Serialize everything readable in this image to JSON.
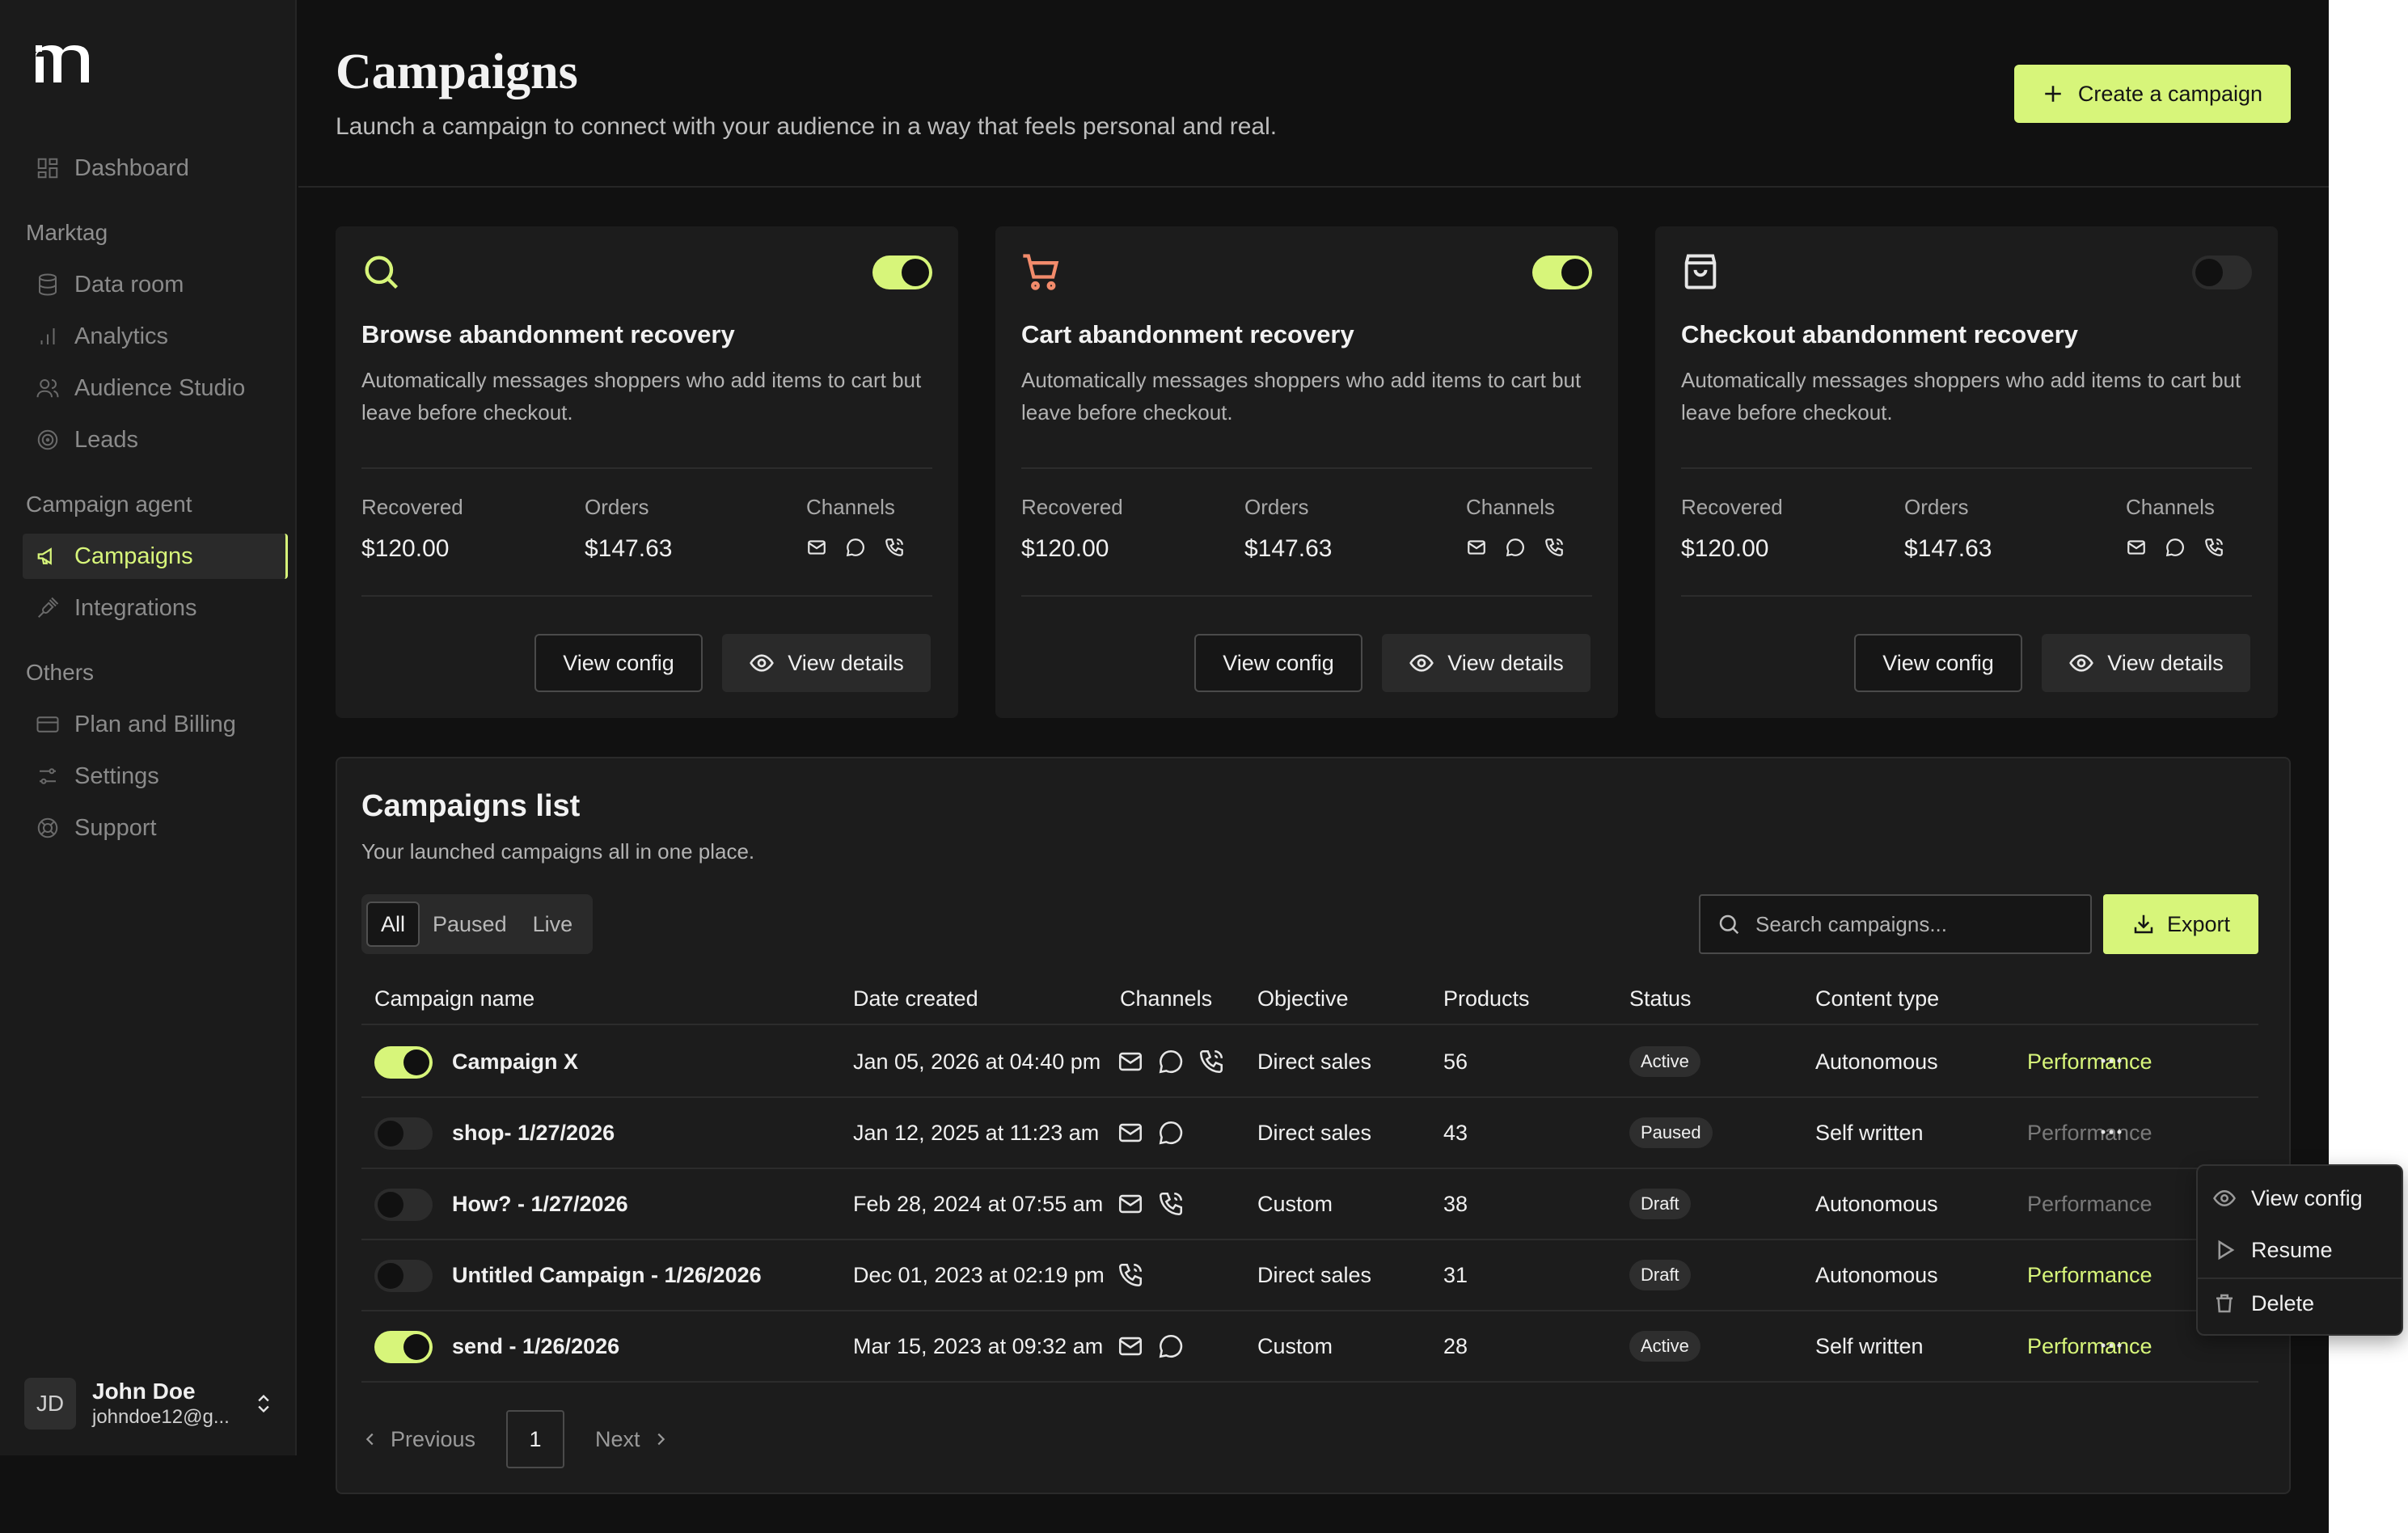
{
  "app": {
    "brand_color": "#d7f57a",
    "background": "#111111"
  },
  "sidebar": {
    "logo": "m-brand-logo",
    "dashboard": "Dashboard",
    "section_marktag": "Marktag",
    "data_room": "Data room",
    "analytics": "Analytics",
    "audience_studio": "Audience Studio",
    "leads": "Leads",
    "section_campaign_agent": "Campaign agent",
    "campaigns": "Campaigns",
    "integrations": "Integrations",
    "section_others": "Others",
    "plan_billing": "Plan and Billing",
    "settings": "Settings",
    "support": "Support",
    "user": {
      "initials": "JD",
      "name": "John Doe",
      "email": "johndoe12@g..."
    }
  },
  "header": {
    "title": "Campaigns",
    "subtitle": "Launch a campaign to connect with your audience in a way that feels personal and real.",
    "create_button": "Create a campaign"
  },
  "cards": [
    {
      "icon": "search-icon",
      "icon_color": "#d7f57a",
      "enabled": true,
      "title": "Browse abandonment recovery",
      "description": "Automatically messages shoppers who add items to cart but leave before checkout.",
      "recovered_label": "Recovered",
      "recovered": "$120.00",
      "orders_label": "Orders",
      "orders": "$147.63",
      "channels_label": "Channels",
      "view_config": "View config",
      "view_details": "View details"
    },
    {
      "icon": "cart-icon",
      "icon_color": "#f28b6b",
      "enabled": true,
      "title": "Cart abandonment recovery",
      "description": "Automatically messages shoppers who add items to cart but leave before checkout.",
      "recovered_label": "Recovered",
      "recovered": "$120.00",
      "orders_label": "Orders",
      "orders": "$147.63",
      "channels_label": "Channels",
      "view_config": "View config",
      "view_details": "View details"
    },
    {
      "icon": "shopping-bag-icon",
      "icon_color": "#e6e6e6",
      "enabled": false,
      "title": "Checkout abandonment recovery",
      "description": "Automatically messages shoppers who add items to cart but leave before checkout.",
      "recovered_label": "Recovered",
      "recovered": "$120.00",
      "orders_label": "Orders",
      "orders": "$147.63",
      "channels_label": "Channels",
      "view_config": "View config",
      "view_details": "View details"
    }
  ],
  "list": {
    "title": "Campaigns list",
    "subtitle": "Your launched campaigns all in one place.",
    "tabs": [
      "All",
      "Paused",
      "Live"
    ],
    "active_tab": "All",
    "search_placeholder": "Search campaigns...",
    "export": "Export",
    "columns": [
      "Campaign name",
      "Date created",
      "Channels",
      "Objective",
      "Products",
      "Status",
      "Content type"
    ],
    "rows": [
      {
        "enabled": true,
        "name": "Campaign X",
        "date": "Jan 05, 2026 at 04:40 pm",
        "channels": [
          "mail",
          "chat",
          "phone"
        ],
        "objective": "Direct sales",
        "products": "56",
        "status": "Active",
        "content_type": "Autonomous",
        "metric": "Performance",
        "metric_highlight": true
      },
      {
        "enabled": false,
        "name": "shop- 1/27/2026",
        "date": "Jan 12, 2025 at 11:23 am",
        "channels": [
          "mail",
          "chat"
        ],
        "objective": "Direct sales",
        "products": "43",
        "status": "Paused",
        "content_type": "Self written",
        "metric": "Performance",
        "metric_highlight": false
      },
      {
        "enabled": false,
        "name": "How? - 1/27/2026",
        "date": "Feb 28, 2024 at 07:55 am",
        "channels": [
          "mail",
          "phone"
        ],
        "objective": "Custom",
        "products": "38",
        "status": "Draft",
        "content_type": "Autonomous",
        "metric": "Performance",
        "metric_highlight": false
      },
      {
        "enabled": false,
        "name": "Untitled Campaign - 1/26/2026",
        "date": "Dec 01, 2023 at 02:19 pm",
        "channels": [
          "phone"
        ],
        "objective": "Direct sales",
        "products": "31",
        "status": "Draft",
        "content_type": "Autonomous",
        "metric": "Performance",
        "metric_highlight": true
      },
      {
        "enabled": true,
        "name": "send - 1/26/2026",
        "date": "Mar 15, 2023 at 09:32 am",
        "channels": [
          "mail",
          "chat"
        ],
        "objective": "Custom",
        "products": "28",
        "status": "Active",
        "content_type": "Self written",
        "metric": "Performance",
        "metric_highlight": true
      }
    ],
    "pagination": {
      "previous": "Previous",
      "page": "1",
      "next": "Next"
    }
  },
  "context_menu": {
    "view_config": "View config",
    "resume": "Resume",
    "delete": "Delete"
  }
}
